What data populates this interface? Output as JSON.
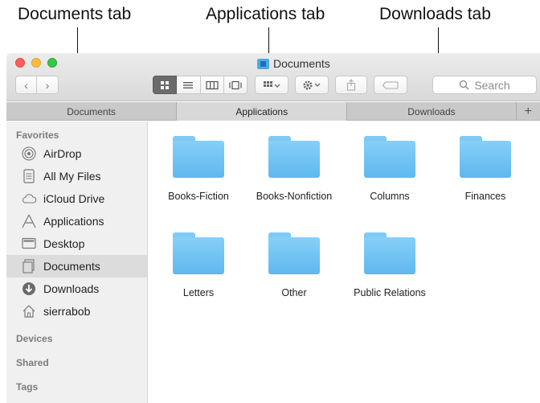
{
  "annotations": {
    "documents_tab": "Documents tab",
    "applications_tab": "Applications tab",
    "downloads_tab": "Downloads tab"
  },
  "window": {
    "title": "Documents",
    "search_placeholder": "Search",
    "nav": {
      "back": "‹",
      "forward": "›"
    }
  },
  "tabs": [
    {
      "label": "Documents",
      "active": false
    },
    {
      "label": "Applications",
      "active": true
    },
    {
      "label": "Downloads",
      "active": false
    }
  ],
  "tab_add": "+",
  "sidebar": {
    "headings": {
      "favorites": "Favorites",
      "devices": "Devices",
      "shared": "Shared",
      "tags": "Tags"
    },
    "items": [
      {
        "label": "AirDrop",
        "icon": "airdrop-icon"
      },
      {
        "label": "All My Files",
        "icon": "all-my-files-icon"
      },
      {
        "label": "iCloud Drive",
        "icon": "cloud-icon"
      },
      {
        "label": "Applications",
        "icon": "applications-icon"
      },
      {
        "label": "Desktop",
        "icon": "desktop-icon"
      },
      {
        "label": "Documents",
        "icon": "documents-icon",
        "selected": true
      },
      {
        "label": "Downloads",
        "icon": "downloads-icon"
      },
      {
        "label": "sierrabob",
        "icon": "home-icon"
      }
    ]
  },
  "files": [
    {
      "name": "Books-Fiction"
    },
    {
      "name": "Books-Nonfiction"
    },
    {
      "name": "Columns"
    },
    {
      "name": "Finances"
    },
    {
      "name": "Letters"
    },
    {
      "name": "Other"
    },
    {
      "name": "Public Relations"
    }
  ],
  "colors": {
    "folder": "#6ec2f3",
    "close": "#fc605b",
    "minimize": "#fdbc40",
    "zoom": "#34c84a"
  }
}
